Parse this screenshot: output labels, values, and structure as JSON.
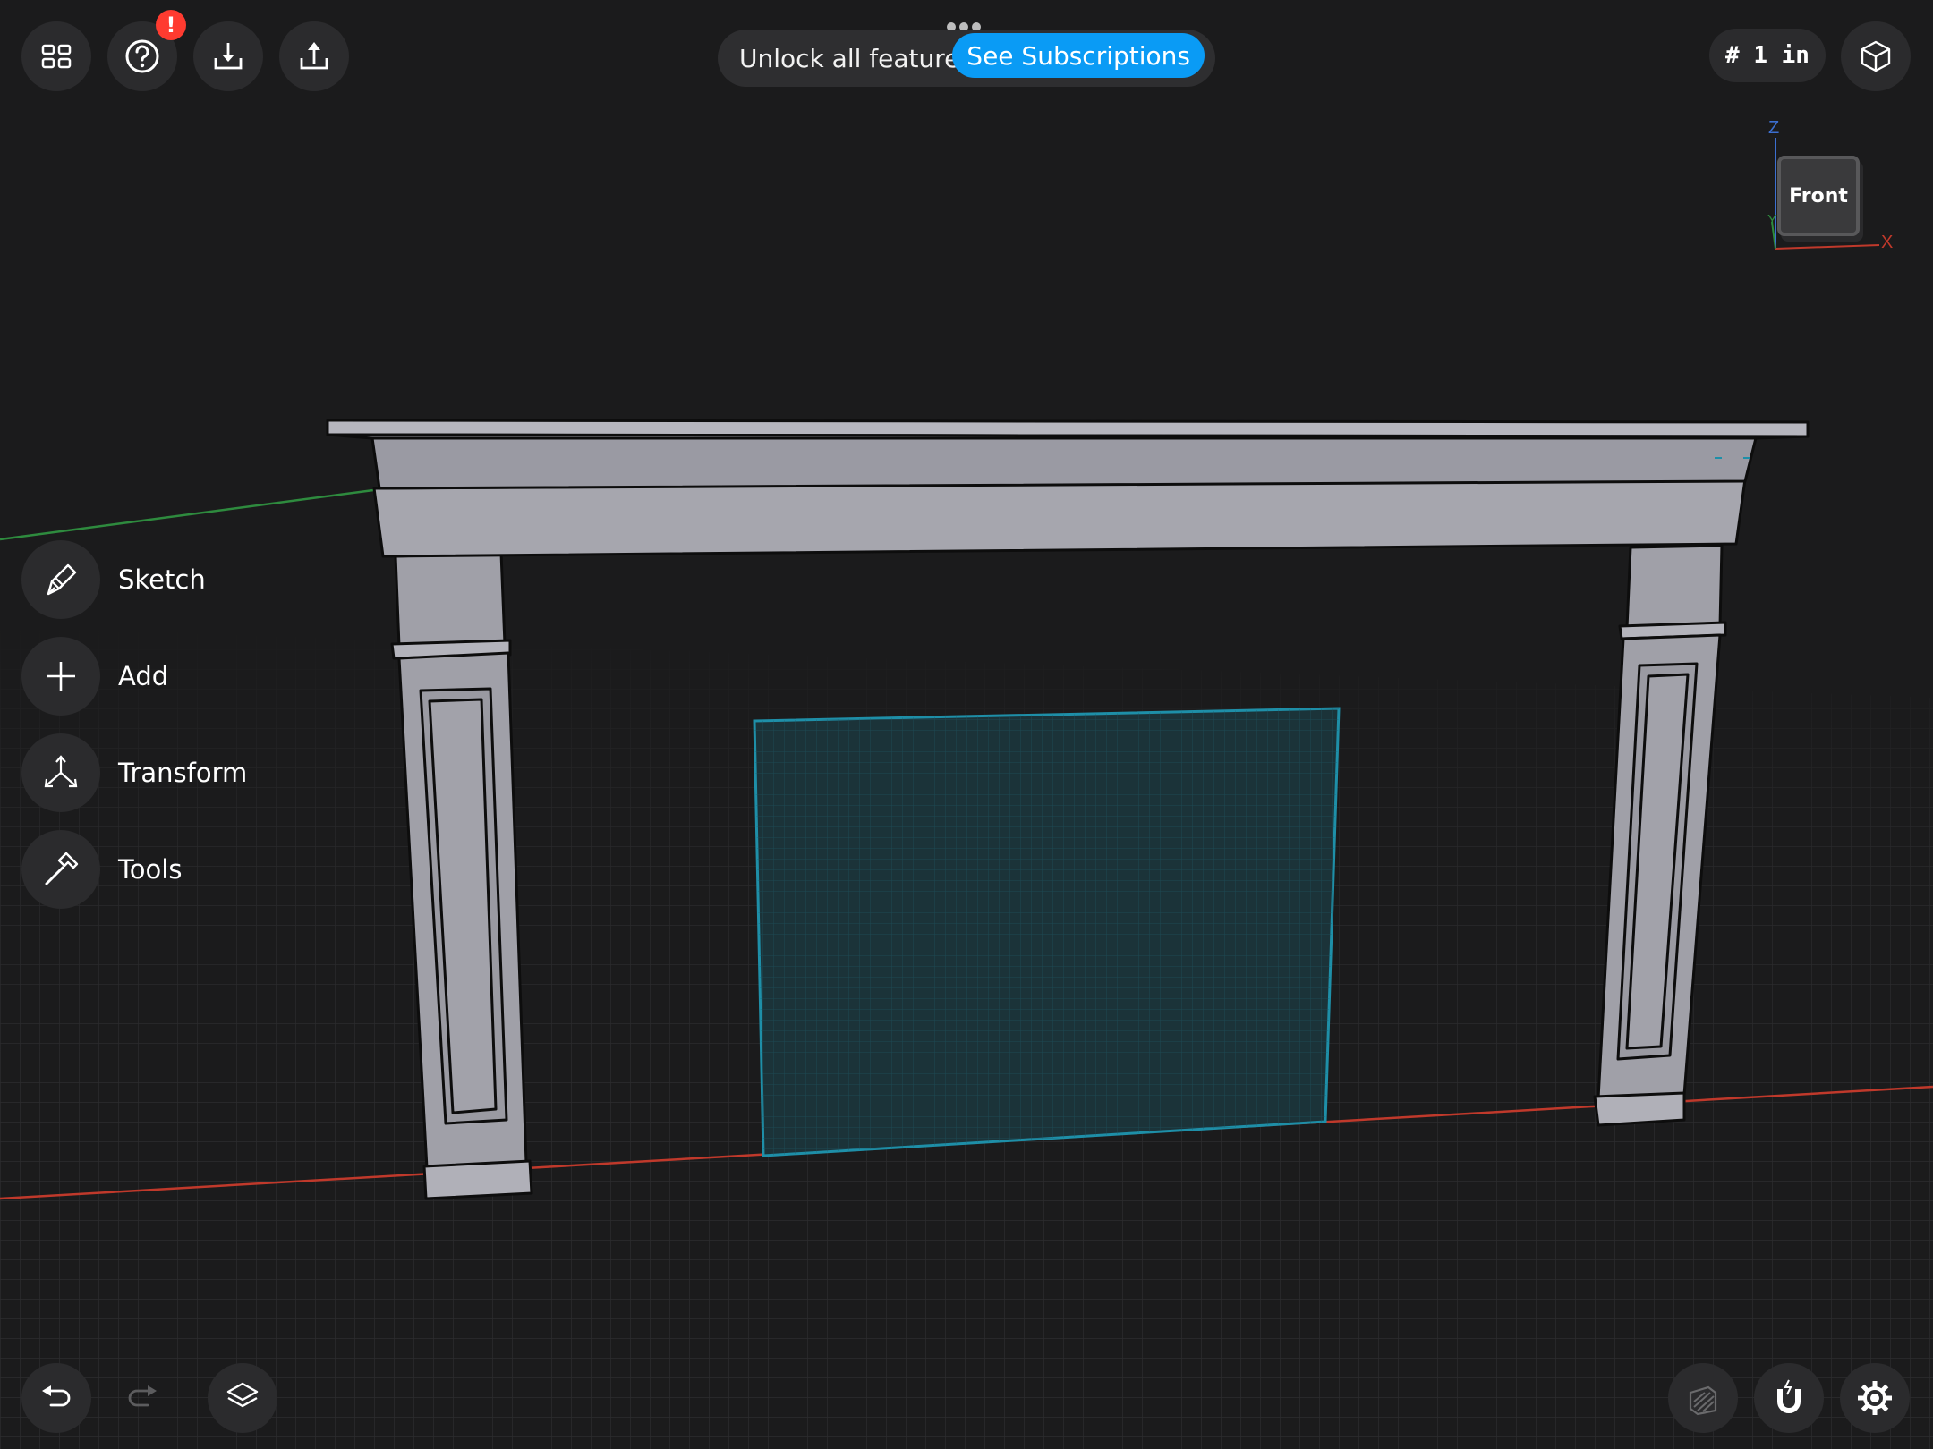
{
  "toolbar": {
    "alert_badge": "!",
    "promo_text": "Unlock all features",
    "promo_button": "See Subscriptions",
    "grid_unit": "# 1 in"
  },
  "tool_menu": [
    {
      "label": "Sketch",
      "icon": "pen-icon"
    },
    {
      "label": "Add",
      "icon": "plus-icon"
    },
    {
      "label": "Transform",
      "icon": "transform-icon"
    },
    {
      "label": "Tools",
      "icon": "hammer-icon"
    }
  ],
  "view_cube": {
    "face": "Front",
    "axis_z": "Z",
    "axis_x": "X",
    "axis_y": "Y"
  },
  "bottom_bar": {
    "undo": "undo-icon",
    "redo": "redo-icon",
    "layers": "layers-icon",
    "section": "section-view-icon",
    "snap": "magnet-icon",
    "settings": "gear-icon"
  },
  "colors": {
    "background": "#1b1b1c",
    "accent": "#0a9bf5",
    "badge": "#ff3b30",
    "x_axis": "#c0392b",
    "y_axis": "#2e8b3e",
    "selection": "#1e8fa8",
    "model": "#a2a2ab"
  }
}
